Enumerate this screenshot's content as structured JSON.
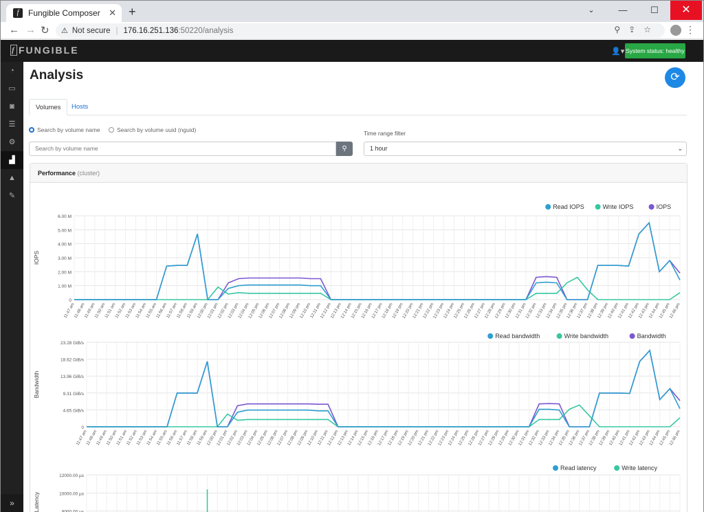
{
  "browser": {
    "tab_title": "Fungible Composer",
    "tab_close": "✕",
    "new_tab": "+",
    "not_secure": "Not secure",
    "url_host": "176.16.251.136",
    "url_path": ":50220/analysis"
  },
  "app": {
    "brand": "FUNGIBLE",
    "system_status": "System status: healthy",
    "sidebar_icons": [
      "dashboard-icon",
      "storage-icon",
      "camera-icon",
      "server-icon",
      "gears-icon",
      "analytics-icon",
      "warning-icon",
      "wrench-icon"
    ],
    "active_sidebar": "analytics-icon"
  },
  "page": {
    "title": "Analysis",
    "tabs": [
      {
        "label": "Volumes"
      },
      {
        "label": "Hosts"
      }
    ],
    "radio_name": "Search by volume name",
    "radio_uuid": "Search by volume uuid (nguid)",
    "search_placeholder": "Search by volume name",
    "time_range_label": "Time range filter",
    "time_range_value": "1 hour",
    "card_title": "Performance",
    "card_subtitle": "(cluster)"
  },
  "colors": {
    "read": "#2e9fcf",
    "write": "#36c7a2",
    "total": "#7b57d1",
    "status_green": "#28a745",
    "accent_blue": "#1e88e5"
  },
  "chart_data": [
    {
      "type": "line",
      "ylabel": "IOPS",
      "ylim": [
        0,
        6000000
      ],
      "yticks": [
        "0",
        "1.00 M",
        "2.00 M",
        "3.00 M",
        "4.00 M",
        "5.00 M",
        "6.00 M"
      ],
      "x": [
        "11:47 am",
        "11:48 am",
        "11:49 am",
        "11:50 am",
        "11:51 am",
        "11:52 am",
        "11:53 am",
        "11:54 am",
        "11:55 am",
        "11:56 am",
        "11:57 am",
        "11:58 am",
        "11:59 am",
        "12:00 pm",
        "12:01 pm",
        "12:02 pm",
        "12:03 pm",
        "12:04 pm",
        "12:05 pm",
        "12:06 pm",
        "12:07 pm",
        "12:08 pm",
        "12:09 pm",
        "12:10 pm",
        "12:11 pm",
        "12:12 pm",
        "12:13 pm",
        "12:14 pm",
        "12:15 pm",
        "12:16 pm",
        "12:17 pm",
        "12:18 pm",
        "12:19 pm",
        "12:20 pm",
        "12:21 pm",
        "12:22 pm",
        "12:23 pm",
        "12:24 pm",
        "12:25 pm",
        "12:26 pm",
        "12:27 pm",
        "12:28 pm",
        "12:29 pm",
        "12:30 pm",
        "12:31 pm",
        "12:32 pm",
        "12:33 pm",
        "12:34 pm",
        "12:35 pm",
        "12:36 pm",
        "12:37 pm",
        "12:38 pm",
        "12:39 pm",
        "12:40 pm",
        "12:41 pm",
        "12:42 pm",
        "12:43 pm",
        "12:44 pm",
        "12:45 pm",
        "12:46 pm"
      ],
      "series": [
        {
          "name": "Read IOPS",
          "values": [
            0,
            0,
            0,
            0,
            0,
            0,
            0,
            0,
            0,
            2400000,
            2450000,
            2450000,
            4700000,
            0,
            0,
            800000,
            1000000,
            1050000,
            1050000,
            1050000,
            1050000,
            1050000,
            1050000,
            1000000,
            1000000,
            0,
            0,
            0,
            0,
            0,
            0,
            0,
            0,
            0,
            0,
            0,
            0,
            0,
            0,
            0,
            0,
            0,
            0,
            0,
            0,
            1200000,
            1250000,
            1200000,
            0,
            0,
            0,
            2450000,
            2450000,
            2450000,
            2400000,
            4700000,
            5500000,
            2000000,
            2800000,
            1400000
          ]
        },
        {
          "name": "Write IOPS",
          "values": [
            0,
            0,
            0,
            0,
            0,
            0,
            0,
            0,
            0,
            0,
            0,
            0,
            0,
            0,
            900000,
            400000,
            500000,
            450000,
            450000,
            450000,
            450000,
            450000,
            450000,
            450000,
            450000,
            0,
            0,
            0,
            0,
            0,
            0,
            0,
            0,
            0,
            0,
            0,
            0,
            0,
            0,
            0,
            0,
            0,
            0,
            0,
            0,
            450000,
            450000,
            450000,
            1200000,
            1600000,
            700000,
            0,
            0,
            0,
            0,
            0,
            0,
            0,
            0,
            500000
          ]
        },
        {
          "name": "IOPS",
          "values": [
            0,
            0,
            0,
            0,
            0,
            0,
            0,
            0,
            0,
            2400000,
            2450000,
            2450000,
            4700000,
            0,
            0,
            1200000,
            1500000,
            1550000,
            1550000,
            1550000,
            1550000,
            1550000,
            1550000,
            1500000,
            1500000,
            0,
            0,
            0,
            0,
            0,
            0,
            0,
            0,
            0,
            0,
            0,
            0,
            0,
            0,
            0,
            0,
            0,
            0,
            0,
            0,
            1600000,
            1650000,
            1600000,
            0,
            0,
            0,
            2450000,
            2450000,
            2450000,
            2400000,
            4700000,
            5500000,
            2000000,
            2800000,
            1900000
          ]
        }
      ],
      "legend": "top-right"
    },
    {
      "type": "line",
      "ylabel": "Bandwidth",
      "ylim": [
        0,
        23.28
      ],
      "yticks": [
        "0",
        "4.65 GiB/s",
        "9.31 GiB/s",
        "13.96 GiB/s",
        "18.62 GiB/s",
        "23.28 GiB/s"
      ],
      "x": [
        "11:47 am",
        "11:48 am",
        "11:49 am",
        "11:50 am",
        "11:51 am",
        "11:52 am",
        "11:53 am",
        "11:54 am",
        "11:55 am",
        "11:56 am",
        "11:57 am",
        "11:58 am",
        "11:59 am",
        "12:00 pm",
        "12:01 pm",
        "12:02 pm",
        "12:03 pm",
        "12:04 pm",
        "12:05 pm",
        "12:06 pm",
        "12:07 pm",
        "12:08 pm",
        "12:09 pm",
        "12:10 pm",
        "12:11 pm",
        "12:12 pm",
        "12:13 pm",
        "12:14 pm",
        "12:15 pm",
        "12:16 pm",
        "12:17 pm",
        "12:18 pm",
        "12:19 pm",
        "12:20 pm",
        "12:21 pm",
        "12:22 pm",
        "12:23 pm",
        "12:24 pm",
        "12:25 pm",
        "12:26 pm",
        "12:27 pm",
        "12:28 pm",
        "12:29 pm",
        "12:30 pm",
        "12:31 pm",
        "12:32 pm",
        "12:33 pm",
        "12:34 pm",
        "12:35 pm",
        "12:36 pm",
        "12:37 pm",
        "12:38 pm",
        "12:39 pm",
        "12:40 pm",
        "12:41 pm",
        "12:42 pm",
        "12:43 pm",
        "12:44 pm",
        "12:45 pm",
        "12:46 pm"
      ],
      "series": [
        {
          "name": "Read bandwidth",
          "values": [
            0,
            0,
            0,
            0,
            0,
            0,
            0,
            0,
            0,
            9.3,
            9.3,
            9.3,
            18.0,
            0,
            0,
            4.0,
            4.6,
            4.6,
            4.6,
            4.6,
            4.6,
            4.6,
            4.6,
            4.4,
            4.4,
            0,
            0,
            0,
            0,
            0,
            0,
            0,
            0,
            0,
            0,
            0,
            0,
            0,
            0,
            0,
            0,
            0,
            0,
            0,
            0,
            4.8,
            4.8,
            4.6,
            0,
            0,
            0,
            9.3,
            9.3,
            9.3,
            9.2,
            18.0,
            21.0,
            7.5,
            10.5,
            5.0
          ]
        },
        {
          "name": "Write bandwidth",
          "values": [
            0,
            0,
            0,
            0,
            0,
            0,
            0,
            0,
            0,
            0,
            0,
            0,
            0,
            0,
            3.5,
            1.8,
            2.0,
            2.0,
            2.0,
            2.0,
            2.0,
            2.0,
            2.0,
            2.0,
            2.0,
            0,
            0,
            0,
            0,
            0,
            0,
            0,
            0,
            0,
            0,
            0,
            0,
            0,
            0,
            0,
            0,
            0,
            0,
            0,
            0,
            2.0,
            2.0,
            2.0,
            4.8,
            6.0,
            3.0,
            0,
            0,
            0,
            0,
            0,
            0,
            0,
            0,
            2.5
          ]
        },
        {
          "name": "Bandwidth",
          "values": [
            0,
            0,
            0,
            0,
            0,
            0,
            0,
            0,
            0,
            9.3,
            9.3,
            9.3,
            18.0,
            0,
            0,
            5.8,
            6.3,
            6.3,
            6.3,
            6.3,
            6.3,
            6.3,
            6.3,
            6.2,
            6.2,
            0,
            0,
            0,
            0,
            0,
            0,
            0,
            0,
            0,
            0,
            0,
            0,
            0,
            0,
            0,
            0,
            0,
            0,
            0,
            0,
            6.3,
            6.4,
            6.3,
            0,
            0,
            0,
            9.3,
            9.3,
            9.3,
            9.2,
            18.0,
            21.0,
            7.5,
            10.5,
            7.2
          ]
        }
      ],
      "legend": "top-right"
    },
    {
      "type": "line",
      "ylabel": "Latency",
      "ylim": [
        6000,
        12000
      ],
      "yticks": [
        "8000.00 µs",
        "10000.00 µs",
        "12000.00 µs"
      ],
      "series": [
        {
          "name": "Read latency"
        },
        {
          "name": "Write latency"
        }
      ],
      "legend": "top-right"
    }
  ]
}
